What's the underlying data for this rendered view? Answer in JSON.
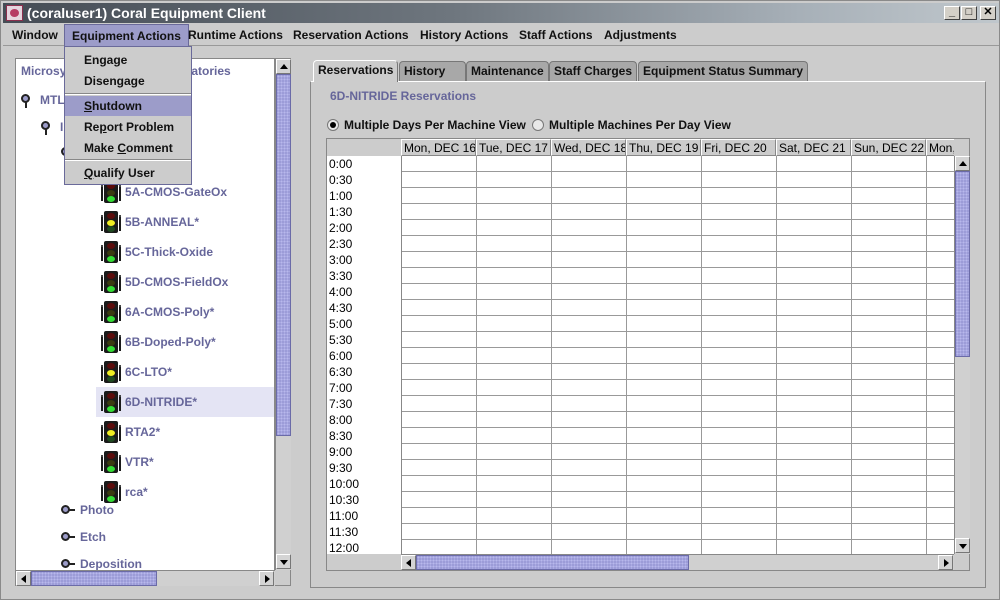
{
  "window": {
    "title": "(coraluser1) Coral Equipment Client",
    "controls": {
      "minimize": "_",
      "maximize": "□",
      "close": "✕"
    }
  },
  "menubar": {
    "items": [
      {
        "label": "Window"
      },
      {
        "label": "Equipment Actions",
        "active": true
      },
      {
        "label": "Runtime Actions"
      },
      {
        "label": "Reservation Actions"
      },
      {
        "label": "History Actions"
      },
      {
        "label": "Staff Actions"
      },
      {
        "label": "Adjustments"
      }
    ]
  },
  "dropdown": {
    "items": [
      {
        "label": "Engage"
      },
      {
        "label": "Disengage"
      },
      {
        "label_pre": "",
        "mnemonic": "S",
        "label_post": "hutdown",
        "highlighted": true
      },
      {
        "label_pre": "Re",
        "mnemonic": "p",
        "label_post": "ort Problem"
      },
      {
        "label_pre": "Make ",
        "mnemonic": "C",
        "label_post": "omment"
      },
      {
        "label_pre": "",
        "mnemonic": "Q",
        "label_post": "ualify User"
      }
    ]
  },
  "tree": {
    "root_left": "Microsy",
    "root_right": "oratories",
    "level1": "MTL",
    "level2": "I",
    "equipment": [
      {
        "name": "5A-CMOS-GateOx",
        "visible_label": "ateOx",
        "light": "green"
      },
      {
        "name": "5B-ANNEAL*",
        "light": "yellow"
      },
      {
        "name": "5C-Thick-Oxide",
        "light": "green"
      },
      {
        "name": "5D-CMOS-FieldOx",
        "light": "green"
      },
      {
        "name": "6A-CMOS-Poly*",
        "light": "green"
      },
      {
        "name": "6B-Doped-Poly*",
        "light": "green"
      },
      {
        "name": "6C-LTO*",
        "light": "yellow"
      },
      {
        "name": "6D-NITRIDE*",
        "light": "green",
        "selected": true
      },
      {
        "name": "RTA2*",
        "light": "yellow"
      },
      {
        "name": "VTR*",
        "light": "green"
      },
      {
        "name": "rca*",
        "light": "green"
      }
    ],
    "collapsed_groups": [
      {
        "name": "Photo"
      },
      {
        "name": "Etch"
      },
      {
        "name": "Deposition"
      }
    ]
  },
  "tabs": [
    {
      "label": "Reservations",
      "active": true
    },
    {
      "label": "History"
    },
    {
      "label": "Maintenance"
    },
    {
      "label": "Staff Charges"
    },
    {
      "label": "Equipment Status Summary"
    }
  ],
  "reservations": {
    "title": "6D-NITRIDE Reservations",
    "view_options": [
      {
        "label": "Multiple Days Per Machine View",
        "selected": true
      },
      {
        "label": "Multiple Machines Per Day View",
        "selected": false
      }
    ],
    "columns": [
      "Mon, DEC 16",
      "Tue, DEC 17",
      "Wed, DEC 18",
      "Thu, DEC 19",
      "Fri, DEC 20",
      "Sat, DEC 21",
      "Sun, DEC 22",
      "Mon,"
    ],
    "times": [
      "0:00",
      "0:30",
      "1:00",
      "1:30",
      "2:00",
      "2:30",
      "3:00",
      "3:30",
      "4:00",
      "4:30",
      "5:00",
      "5:30",
      "6:00",
      "6:30",
      "7:00",
      "7:30",
      "8:00",
      "8:30",
      "9:00",
      "9:30",
      "10:00",
      "10:30",
      "11:00",
      "11:30",
      "12:00"
    ]
  },
  "colors": {
    "accent": "#9c9cc9",
    "tree_text": "#66669a",
    "selection": "#e4e4f4",
    "light_green": "#33dd33",
    "light_yellow": "#eeee22",
    "light_red_off": "#5a0a0a",
    "light_off": "#3a3a10"
  }
}
